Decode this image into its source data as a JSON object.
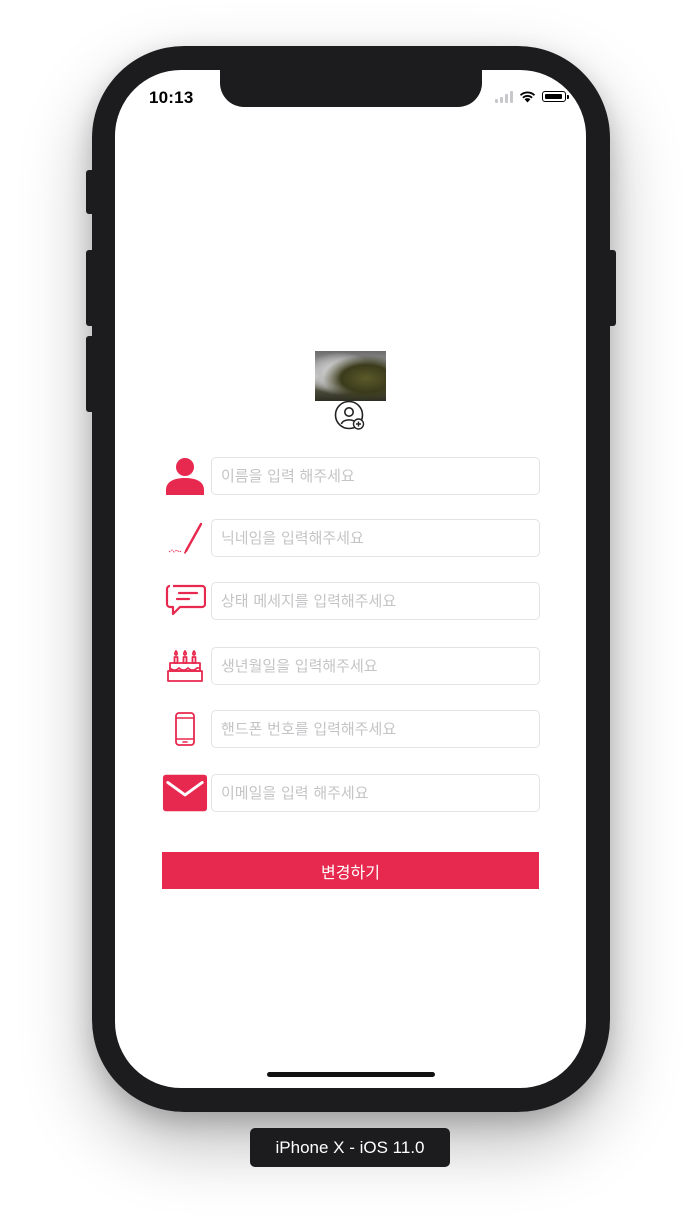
{
  "status_bar": {
    "time": "10:13"
  },
  "profile": {
    "photo_icon": "profile-photo",
    "add_icon": "add-user-icon"
  },
  "form": {
    "fields": [
      {
        "name": "name",
        "icon": "person-icon",
        "value": "",
        "placeholder": "이름을 입력 해주세요"
      },
      {
        "name": "nickname",
        "icon": "pen-icon",
        "value": "",
        "placeholder": "닉네임을 입력해주세요"
      },
      {
        "name": "status",
        "icon": "chat-bubble-icon",
        "value": "",
        "placeholder": "상태 메세지를 입력해주세요"
      },
      {
        "name": "birthday",
        "icon": "cake-icon",
        "value": "",
        "placeholder": "생년월일을 입력해주세요"
      },
      {
        "name": "phone",
        "icon": "mobile-phone-icon",
        "value": "",
        "placeholder": "핸드폰 번호를 입력해주세요"
      },
      {
        "name": "email",
        "icon": "envelope-icon",
        "value": "",
        "placeholder": "이메일을 입력 해주세요"
      }
    ],
    "submit_label": "변경하기"
  },
  "device_label": "iPhone X - iOS 11.0",
  "colors": {
    "accent": "#e8294f",
    "frame": "#1c1c1e",
    "placeholder": "#c4c4c6"
  }
}
